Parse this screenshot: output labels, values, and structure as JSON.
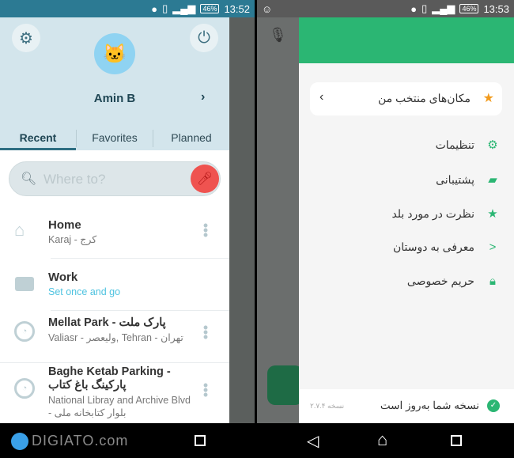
{
  "left_screen": {
    "status": {
      "time": "13:52",
      "battery": "46%",
      "network": "LTE"
    },
    "profile": {
      "name": "Amin B"
    },
    "tabs": [
      {
        "label": "Recent",
        "active": true
      },
      {
        "label": "Favorites"
      },
      {
        "label": "Planned"
      }
    ],
    "search": {
      "placeholder": "Where to?"
    },
    "items": [
      {
        "title": "Home",
        "subtitle": "Karaj - کرج",
        "icon": "home-icon"
      },
      {
        "title": "Work",
        "subtitle": "Set once and go",
        "icon": "briefcase-icon"
      },
      {
        "title": "Mellat Park - پارک ملت",
        "subtitle": "Valiasr - ولیعصر, Tehran - تهران",
        "icon": "clock-icon"
      },
      {
        "title": "Baghe Ketab Parking - پارکینگ باغ کتاب",
        "subtitle": "National Libray and Archive Blvd - بلوار کتابخانه ملی",
        "icon": "clock-icon"
      }
    ],
    "watermark": "DIGIATO.com"
  },
  "right_screen": {
    "status": {
      "time": "13:53",
      "battery": "46%",
      "network": "LTE"
    },
    "favorites_label": "مکان‌های منتخب من",
    "menu": [
      {
        "label": "تنظیمات",
        "icon": "gear-icon"
      },
      {
        "label": "پشتیبانی",
        "icon": "chat-icon"
      },
      {
        "label": "نظرت در مورد بلد",
        "icon": "star-icon"
      },
      {
        "label": "معرفی به دوستان",
        "icon": "share-icon"
      },
      {
        "label": "حریم خصوصی",
        "icon": "lock-icon"
      }
    ],
    "footer": {
      "status": "نسخه شما به‌روز است",
      "version": "نسخه ۲.۷.۴"
    }
  },
  "colors": {
    "waze_header": "#d3e5ec",
    "accent_teal": "#2e6e82",
    "mic_red": "#ef5350",
    "balad_green": "#2bb673"
  }
}
